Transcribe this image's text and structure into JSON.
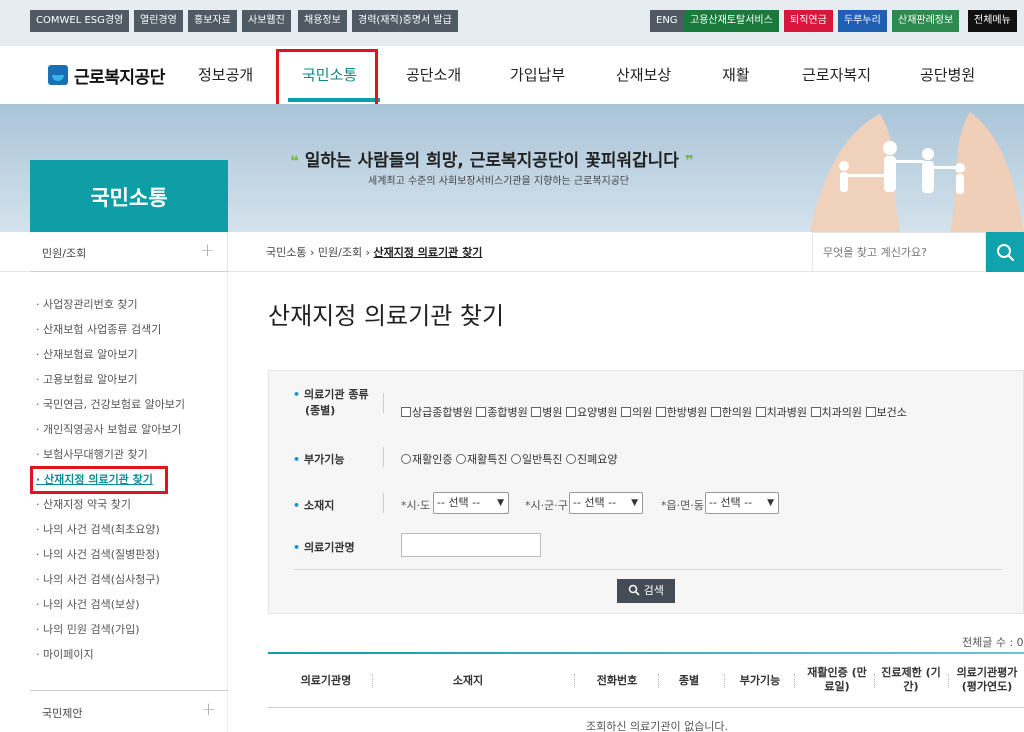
{
  "utility_links": [
    "COMWEL ESG경영",
    "열린경영",
    "홍보자료",
    "사보웹진",
    "채용정보",
    "경력(재직)증명서 발급"
  ],
  "utility_right": [
    {
      "label": "ENG",
      "color": "#505a64"
    },
    {
      "label": "고용산재토탈서비스",
      "color": "#1a7a3c"
    },
    {
      "label": "퇴직연금",
      "color": "#d9163b"
    },
    {
      "label": "두루누리",
      "color": "#1f5fb4"
    },
    {
      "label": "산재판례정보",
      "color": "#2e8b4f"
    },
    {
      "label": "전체메뉴",
      "color": "#111111"
    }
  ],
  "logo_text": "근로복지공단",
  "nav": [
    "정보공개",
    "국민소통",
    "공단소개",
    "가입납부",
    "산재보상",
    "재활",
    "근로자복지",
    "공단병원"
  ],
  "nav_active": "국민소통",
  "hero": {
    "section_title": "국민소통",
    "slogan": "일하는 사람들의 희망, 근로복지공단이 꽃피워갑니다",
    "subtitle": "세계최고 수준의 사회보장서비스기관을 지향하는 근로복지공단"
  },
  "sidebar": {
    "header": "민원/조회",
    "items": [
      "사업장관리번호 찾기",
      "산재보험 사업종류 검색기",
      "산재보험료 알아보기",
      "고용보험료 알아보기",
      "국민연금, 건강보험료 알아보기",
      "개인직영공사 보험료 알아보기",
      "보험사무대행기관 찾기",
      "산재지정 의료기관 찾기",
      "산재지정 약국 찾기",
      "나의 사건 검색(최초요양)",
      "나의 사건 검색(질병판정)",
      "나의 사건 검색(심사청구)",
      "나의 사건 검색(보상)",
      "나의 민원 검색(가입)",
      "마이페이지"
    ],
    "active_item": "산재지정 의료기관 찾기",
    "bottom": "국민제안"
  },
  "breadcrumb": [
    "국민소통",
    "민원/조회",
    "산재지정 의료기관 찾기"
  ],
  "search": {
    "placeholder": "무엇을 찾고 계신가요?"
  },
  "page_title": "산재지정 의료기관 찾기",
  "form": {
    "type_label_1": "의료기관 종류",
    "type_label_2": "(종별)",
    "types": [
      "상급종합병원",
      "종합병원",
      "병원",
      "요양병원",
      "의원",
      "한방병원",
      "한의원",
      "치과병원",
      "치과의원",
      "보건소"
    ],
    "func_label": "부가기능",
    "funcs": [
      "재활인증",
      "재활특진",
      "일반특진",
      "진폐요양"
    ],
    "loc_label": "소재지",
    "sido_label": "*시·도",
    "sigungu_label": "*시·군·구",
    "eupmyeon_label": "*읍·면·동",
    "select_default": "-- 선택 --",
    "name_label": "의료기관명",
    "name_value": "",
    "search_button": "검색"
  },
  "total_count": "전체글 수 : 0",
  "table": {
    "headers": [
      "의료기관명",
      "소재지",
      "전화번호",
      "종별",
      "부가기능",
      "재활인증 (만료일)",
      "진료제한 (기간)",
      "의료기관평가 (평가연도)"
    ],
    "empty_message": "조회하신 의료기관이 없습니다."
  }
}
